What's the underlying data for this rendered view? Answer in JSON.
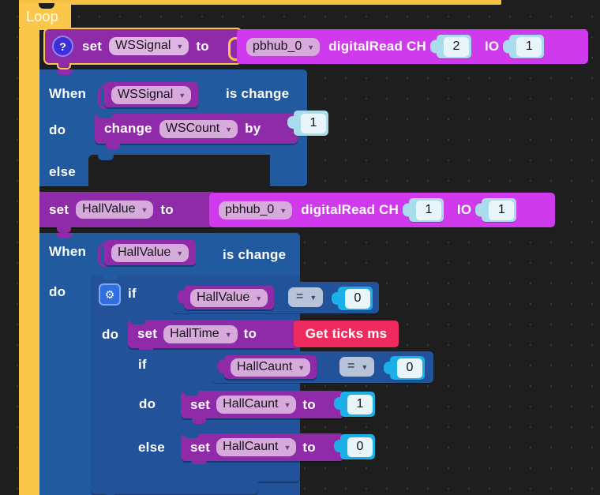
{
  "canvas": {
    "background_color": "#1e1e1e",
    "grid": "dot-grid"
  },
  "loop": {
    "label": "Loop",
    "color": "#fbc74a"
  },
  "blocks": {
    "set_wssignal": {
      "icon": "question-mark-icon",
      "keyword": "set",
      "variable": "WSSignal",
      "to": "to",
      "color": "#8f2aa8"
    },
    "digital_read_1": {
      "device": "pbhub_0",
      "method": "digitalRead CH",
      "ch": "2",
      "io_label": "IO",
      "io": "1",
      "color": "#cf3bec"
    },
    "when_wssignal": {
      "when": "When",
      "variable": "WSSignal",
      "condition": "is change",
      "do_label": "do",
      "else_label": "else",
      "color": "#215a9e"
    },
    "change_wscount": {
      "keyword": "change",
      "variable": "WSCount",
      "by": "by",
      "value": "1"
    },
    "set_hallvalue": {
      "keyword": "set",
      "variable": "HallValue",
      "to": "to"
    },
    "digital_read_2": {
      "device": "pbhub_0",
      "method": "digitalRead CH",
      "ch": "1",
      "io_label": "IO",
      "io": "1"
    },
    "when_hallvalue": {
      "when": "When",
      "variable": "HallValue",
      "condition": "is change",
      "do_label": "do"
    },
    "if_outer": {
      "icon": "gear-icon",
      "if_label": "if",
      "variable": "HallValue",
      "operator": "=",
      "value": "0",
      "do_label": "do"
    },
    "set_halltime": {
      "keyword": "set",
      "variable": "HallTime",
      "to": "to",
      "value_block": "Get ticks ms",
      "value_color": "#ef2a5e"
    },
    "if_inner": {
      "if_label": "if",
      "variable": "HallCaunt",
      "operator": "=",
      "value": "0",
      "do_label": "do",
      "else_label": "else"
    },
    "set_hallcaunt_do": {
      "keyword": "set",
      "variable": "HallCaunt",
      "to": "to",
      "value": "1"
    },
    "set_hallcaunt_else": {
      "keyword": "set",
      "variable": "HallCaunt",
      "to": "to",
      "value": "0"
    }
  }
}
